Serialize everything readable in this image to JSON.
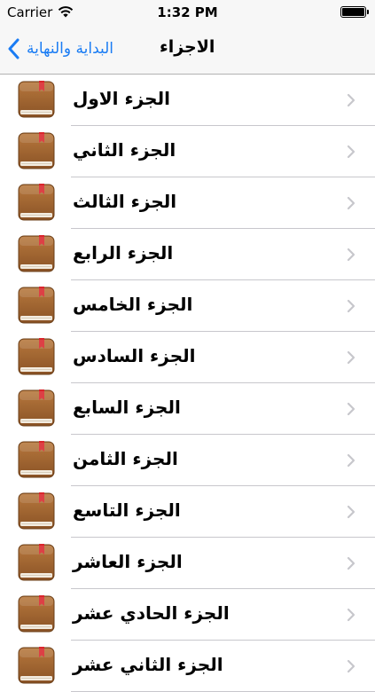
{
  "status_bar": {
    "carrier": "Carrier",
    "time": "1:32 PM",
    "icons": [
      "wifi-icon",
      "battery-icon"
    ]
  },
  "nav": {
    "back_label": "البداية والنهاية",
    "back_icon": "chevron-left-icon",
    "title": "الاجزاء",
    "accent_color": "#1a7cf4"
  },
  "list": {
    "row_icon": "book-icon",
    "row_accessory": "chevron-right-icon",
    "items": [
      {
        "label": "الجزء الاول"
      },
      {
        "label": "الجزء الثاني"
      },
      {
        "label": "الجزء الثالث"
      },
      {
        "label": "الجزء الرابع"
      },
      {
        "label": "الجزء الخامس"
      },
      {
        "label": "الجزء السادس"
      },
      {
        "label": "الجزء السابع"
      },
      {
        "label": "الجزء الثامن"
      },
      {
        "label": "الجزء التاسع"
      },
      {
        "label": "الجزء العاشر"
      },
      {
        "label": "الجزء الحادي عشر"
      },
      {
        "label": "الجزء الثاني عشر"
      }
    ]
  }
}
